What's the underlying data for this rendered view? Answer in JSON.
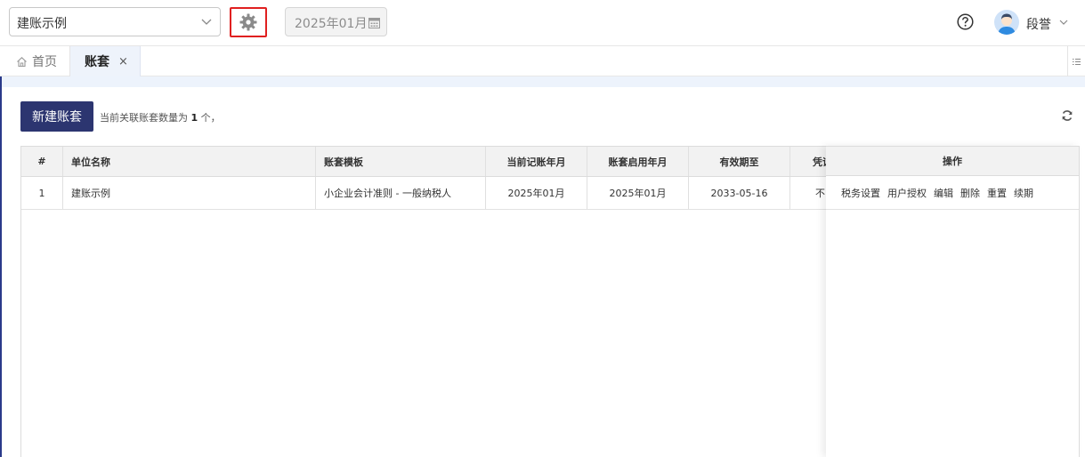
{
  "topbar": {
    "company_select": "建账示例",
    "period": "2025年01月",
    "user_name": "段誉"
  },
  "tabs": [
    {
      "label": "首页"
    },
    {
      "label": "账套",
      "close": "×"
    }
  ],
  "toolbar": {
    "new_button": "新建账套",
    "count_prefix": "当前关联账套数量为",
    "count_value": "1",
    "count_suffix": "个，"
  },
  "table": {
    "headers": [
      "#",
      "单位名称",
      "账套模板",
      "当前记账年月",
      "账套启用年月",
      "有效期至",
      "凭证"
    ],
    "actions_header": "操作",
    "rows": [
      {
        "index": "1",
        "name": "建账示例",
        "template": "小企业会计准则 - 一般纳税人",
        "current_period": "2025年01月",
        "start_period": "2025年01月",
        "valid_until": "2033-05-16",
        "voucher": "不",
        "actions": [
          "税务设置",
          "用户授权",
          "编辑",
          "删除",
          "重置",
          "续期"
        ]
      }
    ]
  },
  "colors": {
    "primary": "#2c3570",
    "highlight_border": "#e02020",
    "tab_active_bg": "#eef3fb"
  }
}
